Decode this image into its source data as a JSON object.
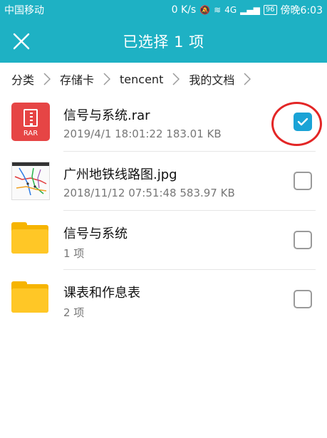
{
  "status_bar": {
    "carrier": "中国移动",
    "speed": "0 K/s",
    "network": "4G",
    "battery": "96",
    "time": "傍晚6:03"
  },
  "header": {
    "title": "已选择 1 项"
  },
  "breadcrumb": [
    "分类",
    "存储卡",
    "tencent",
    "我的文档"
  ],
  "files": [
    {
      "name": "信号与系统.rar",
      "meta": "2019/4/1 18:01:22 183.01 KB",
      "icon": "rar-icon",
      "icon_label": "RAR",
      "checked": true
    },
    {
      "name": "广州地铁线路图.jpg",
      "meta": "2018/11/12 07:51:48 583.97 KB",
      "icon": "image-thumbnail",
      "checked": false
    },
    {
      "name": "信号与系统",
      "meta": "1 项",
      "icon": "folder-icon",
      "checked": false
    },
    {
      "name": "课表和作息表",
      "meta": "2 项",
      "icon": "folder-icon",
      "checked": false
    }
  ],
  "colors": {
    "header_bg": "#1eb1c4",
    "checkbox_checked": "#1aa3d6",
    "highlight_ring": "#e32626",
    "folder": "#ffc726",
    "rar": "#e64545"
  }
}
